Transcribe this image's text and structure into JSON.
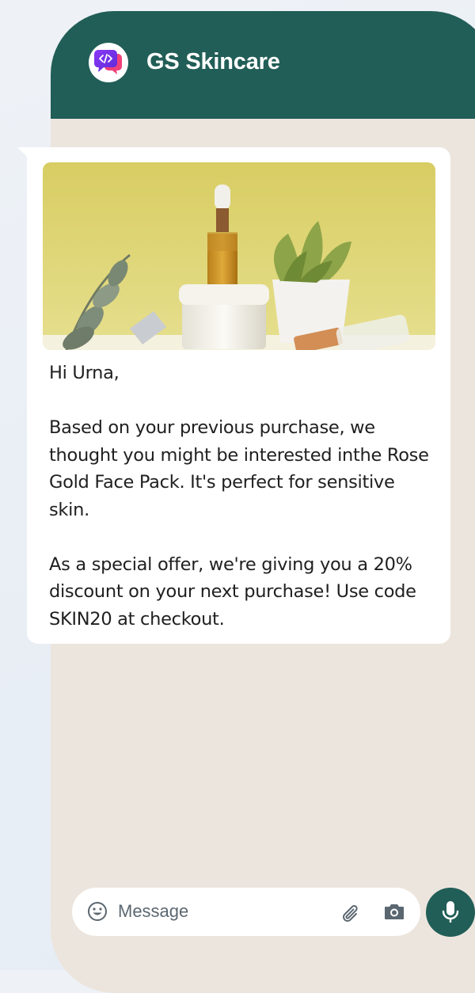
{
  "header": {
    "title": "GS Skincare",
    "avatar_icon": "chat-code-icon"
  },
  "message": {
    "image": "skincare-products-photo",
    "text": "Hi Urna,\n\nBased on your previous purchase, we thought you might be interested inthe Rose Gold Face Pack. It's perfect for sensitive skin.\n\nAs a special offer, we're giving you a 20% discount on your next purchase! Use code SKIN20 at checkout."
  },
  "composer": {
    "placeholder": "Message",
    "icons": [
      "emoji-icon",
      "attachment-icon",
      "camera-icon",
      "mic-icon"
    ]
  },
  "colors": {
    "brand": "#215e57",
    "chat_bg": "#ece5de",
    "bubble": "#ffffff"
  }
}
